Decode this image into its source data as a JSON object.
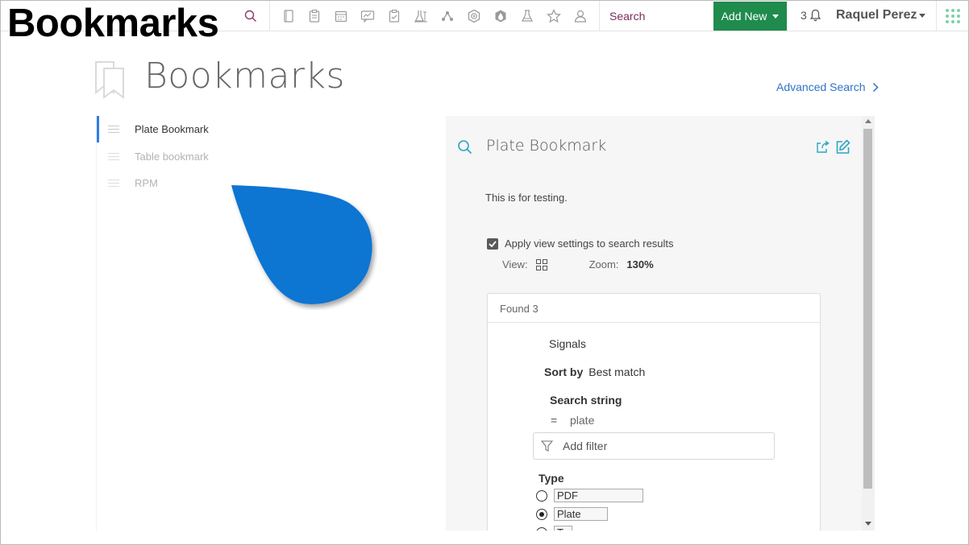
{
  "caption": "Bookmarks",
  "topbar": {
    "search_placeholder": "Search",
    "add_new_label": "Add New",
    "notification_count": "3",
    "user_name": "Raquel Perez",
    "toolbar_icons": [
      "notebook-icon",
      "clipboard-icon",
      "calendar-icon",
      "chat-chart-icon",
      "clipboard-check-icon",
      "lab-flask-stand-icon",
      "molecule-icon",
      "hexagon-target-icon",
      "shield-drop-icon",
      "flask-icon",
      "star-icon",
      "user-outline-icon"
    ]
  },
  "page": {
    "title": "Bookmarks",
    "advanced_search_label": "Advanced Search"
  },
  "bookmarks": [
    {
      "label": "Plate Bookmark",
      "active": true
    },
    {
      "label": "Table bookmark",
      "active": false
    },
    {
      "label": "RPM",
      "active": false
    }
  ],
  "detail": {
    "title": "Plate Bookmark",
    "description": "This is for testing.",
    "apply_label": "Apply view settings to search results",
    "apply_checked": true,
    "view_label": "View:",
    "zoom_label": "Zoom:",
    "zoom_value": "130%",
    "results": {
      "found_label": "Found 3",
      "signals_label": "Signals",
      "sort_by_label": "Sort by",
      "sort_by_value": "Best match",
      "search_string_label": "Search string",
      "search_string_operator": "=",
      "search_string_value": "plate",
      "add_filter_label": "Add filter",
      "type_label": "Type",
      "type_options": [
        {
          "label": "PDF",
          "selected": false
        },
        {
          "label": "Plate",
          "selected": true
        },
        {
          "label": "T",
          "selected": false
        }
      ]
    }
  },
  "colors": {
    "accent_blue": "#2f74c9",
    "add_new_green": "#1f8b4c",
    "active_indicator": "#2f7ee6",
    "cursor_blob": "#0a74d2"
  }
}
